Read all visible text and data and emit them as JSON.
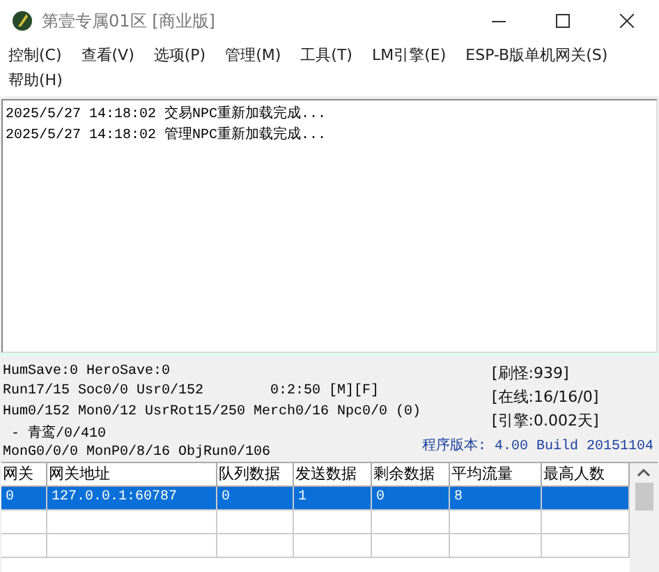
{
  "window": {
    "title": "第壹专属01区 [商业版]"
  },
  "menu": [
    {
      "label": "控制(C)"
    },
    {
      "label": "查看(V)"
    },
    {
      "label": "选项(P)"
    },
    {
      "label": "管理(M)"
    },
    {
      "label": "工具(T)"
    },
    {
      "label": "LM引擎(E)"
    },
    {
      "label": "ESP-B版单机网关(S)"
    },
    {
      "label": "帮助(H)"
    }
  ],
  "log": [
    "2025/5/27 14:18:02 交易NPC重新加载完成...",
    "2025/5/27 14:18:02 管理NPC重新加载完成..."
  ],
  "status": {
    "lines": [
      {
        "text": "HumSave:0 HeroSave:0"
      },
      {
        "text": "Run17/15 Soc0/0 Usr0/152",
        "extra": "0:2:50 [M][F]"
      },
      {
        "text": "Hum0/152 Mon0/12 UsrRot15/250 Merch0/16 Npc0/0 (0)"
      },
      {
        "text": " - 青鸾/0/410"
      },
      {
        "text": "MonG0/0/0 MonP0/8/16 ObjRun0/106"
      }
    ],
    "counters": [
      "[刷怪:939]",
      "[在线:16/16/0]",
      "[引擎:0.002天]"
    ],
    "version": "程序版本: 4.00 Build 20151104"
  },
  "table": {
    "columns": [
      "网关",
      "网关地址",
      "队列数据",
      "发送数据",
      "剩余数据",
      "平均流量",
      "最高人数"
    ],
    "rows": [
      {
        "selected": true,
        "cells": [
          "0",
          "127.0.0.1:60787",
          "0",
          "1",
          "0",
          "8",
          ""
        ]
      }
    ]
  }
}
